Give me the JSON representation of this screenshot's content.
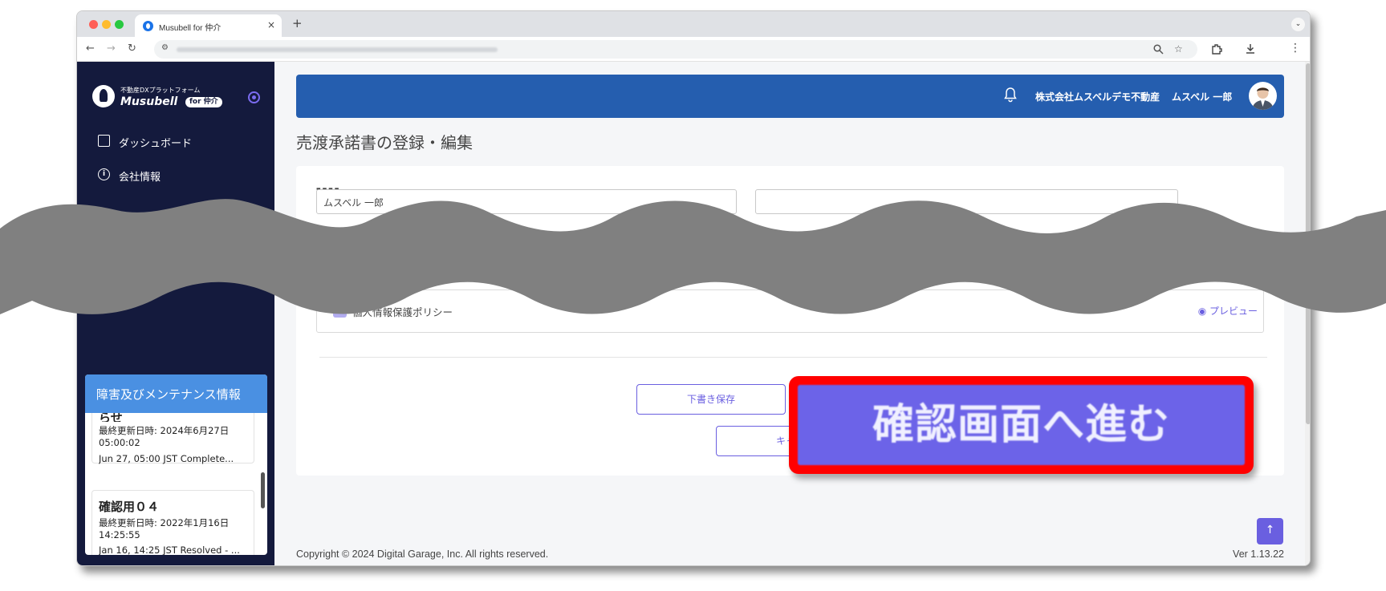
{
  "browser": {
    "tab_title": "Musubell for 仲介",
    "tab_close": "×",
    "new_tab": "+",
    "tab_menu": "⌄",
    "nav_back": "←",
    "nav_forward": "→",
    "nav_reload": "↻"
  },
  "sidebar": {
    "logo_subtitle": "不動産DXプラットフォーム",
    "logo_name": "Musubell",
    "logo_badge": "for 仲介",
    "items": [
      {
        "label": "ダッシュボード",
        "icon": "dashboard-icon"
      },
      {
        "label": "会社情報",
        "icon": "info-icon"
      }
    ]
  },
  "maintenance": {
    "title": "障害及びメンテナンス情報",
    "cards": [
      {
        "title_fragment": "らせ",
        "updated": "最終更新日時: 2024年6月27日 05:00:02",
        "desc": "Jun 27, 05:00 JST Complete..."
      },
      {
        "title": "確認用０４",
        "updated": "最終更新日時: 2022年1月16日 14:25:55",
        "desc": "Jan 16, 14:25 JST Resolved - ..."
      }
    ]
  },
  "header": {
    "company": "株式会社ムスベルデモ不動産",
    "user": "ムスベル 一郎"
  },
  "page": {
    "title": "売渡承諾書の登録・編集",
    "field_value": "ムスベル 一郎",
    "policy_label": "個人情報保護ポリシー",
    "preview_label": "プレビュー",
    "draft_button": "下書き保存",
    "cancel_button": "キャン",
    "scroll_top": "↑"
  },
  "footer": {
    "copyright": "Copyright © 2024 Digital Garage, Inc. All rights reserved.",
    "version": "Ver 1.13.22"
  },
  "annotation": {
    "callout_text": "確認画面へ進む"
  },
  "colors": {
    "sidebar_bg": "#141a3d",
    "header_bg": "#255eaf",
    "accent": "#6a5fe0",
    "maintenance_header": "#4a90e2",
    "callout_border": "#ff0000"
  }
}
